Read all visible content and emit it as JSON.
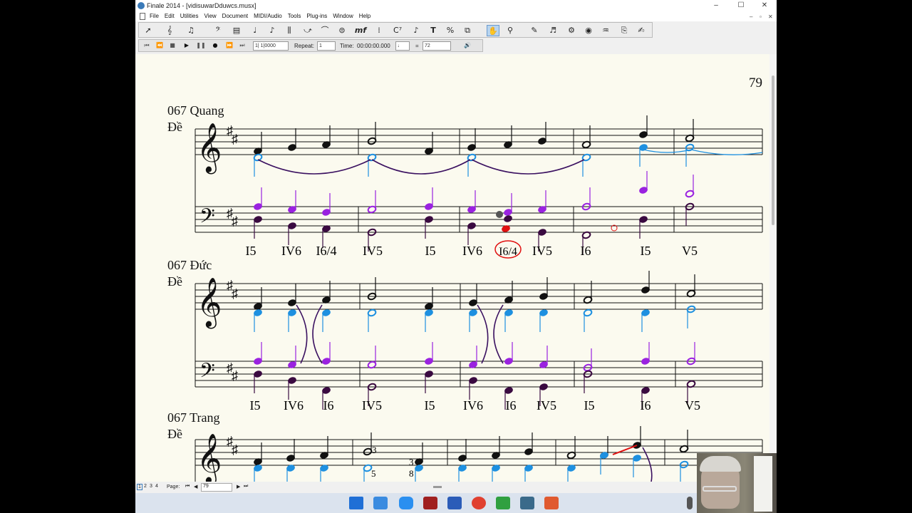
{
  "window": {
    "title": "Finale 2014 - [vidisuwarDduwcs.musx]",
    "min": "–",
    "max": "☐",
    "close": "✕"
  },
  "menu": [
    "File",
    "Edit",
    "Utilities",
    "View",
    "Document",
    "MIDI/Audio",
    "Tools",
    "Plug-ins",
    "Window",
    "Help"
  ],
  "playback": {
    "position": "1| 1|0000",
    "repeat_label": "Repeat:",
    "repeat": "1",
    "time_label": "Time:",
    "time": "00:00:00.000",
    "eq": "=",
    "tempo": "72"
  },
  "status": {
    "pages": [
      "1",
      "2",
      "3",
      "4"
    ],
    "page_label": "Page:",
    "page": "79"
  },
  "score": {
    "page_number": "79",
    "systems": [
      {
        "title": "067 Quang",
        "sub": "Đề"
      },
      {
        "title": "067 Đức",
        "sub": "Đề"
      },
      {
        "title": "067 Trang",
        "sub": "Đề"
      }
    ],
    "chords1": [
      "I5",
      "IV6",
      "I6/4",
      "IV5",
      "I5",
      "IV6",
      "I6/4",
      "IV5",
      "I6",
      "I5",
      "V5"
    ],
    "chords2": [
      "I5",
      "IV6",
      "I6",
      "IV5",
      "I5",
      "IV6",
      "I6",
      "IV5",
      "I5",
      "I6",
      "V5"
    ],
    "fingering": [
      "3",
      "5",
      "3",
      "8"
    ]
  },
  "colors": {
    "black_note": "#111111",
    "blue_note": "#1e90e0",
    "purple_note": "#9a22e0",
    "dark_purple": "#3a0a40",
    "red": "#e01010"
  },
  "icons": [
    "select-tool",
    "staff-tool",
    "simple-entry",
    "key-sig",
    "time-sig",
    "clef",
    "measure",
    "note-mover",
    "tuplet",
    "smart-shape",
    "articulation",
    "expression",
    "repeat",
    "chord",
    "lyrics",
    "text",
    "resize",
    "graphics",
    "hand-grabber",
    "zoom",
    "speedy-entry",
    "mirror",
    "special-tools",
    "ossia",
    "midi-tool",
    "page-layout",
    "hyperscribe"
  ]
}
